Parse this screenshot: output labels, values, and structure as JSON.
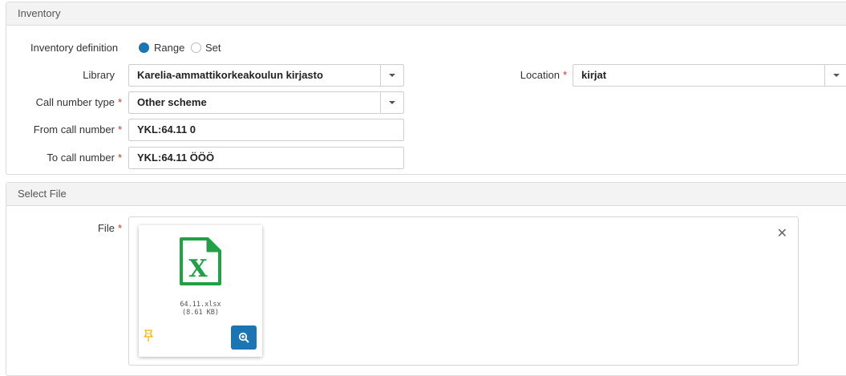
{
  "inventory": {
    "header": "Inventory",
    "definition_label": "Inventory definition",
    "options": [
      "Range",
      "Set"
    ],
    "selected_option": "Range",
    "library": {
      "label": "Library",
      "value": "Karelia-ammattikorkeakoulun kirjasto"
    },
    "location": {
      "label": "Location",
      "value": "kirjat"
    },
    "call_number_type": {
      "label": "Call number type",
      "value": "Other scheme"
    },
    "from_call_number": {
      "label": "From call number",
      "value": "YKL:64.11 0"
    },
    "to_call_number": {
      "label": "To call number",
      "value": "YKL:64.11 ÖÖÖ"
    },
    "required_mark": "*"
  },
  "select_file": {
    "header": "Select File",
    "file_label": "File",
    "file": {
      "name": "64.11.xlsx",
      "size": "(8.61 KB)",
      "icon": "excel-file-icon"
    }
  },
  "colors": {
    "accent": "#1b74b3",
    "excel_green": "#22a046",
    "required": "#d9302c",
    "pin": "#f0b400"
  }
}
